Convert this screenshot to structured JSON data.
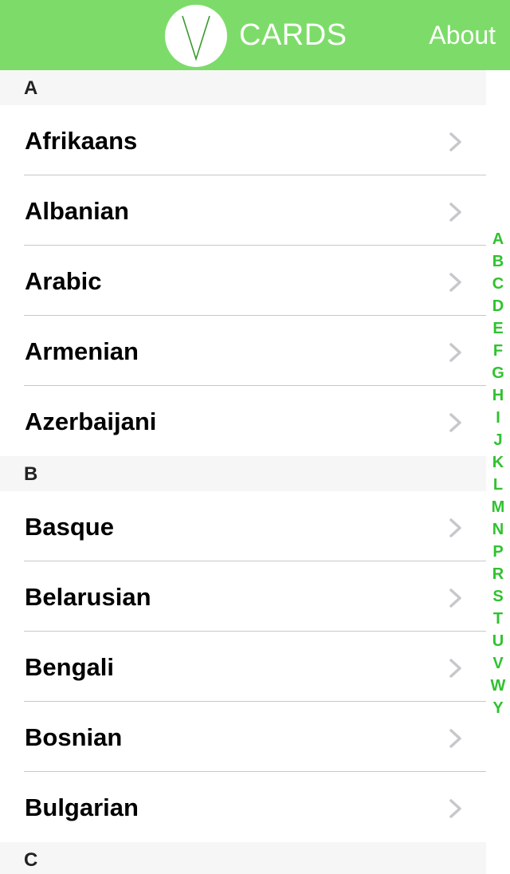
{
  "header": {
    "brand": "CARDS",
    "about_label": "About",
    "background_color": "#7ddc69",
    "logo_icon": "v-logo-icon"
  },
  "sections": [
    {
      "letter": "A",
      "items": [
        "Afrikaans",
        "Albanian",
        "Arabic",
        "Armenian",
        "Azerbaijani"
      ]
    },
    {
      "letter": "B",
      "items": [
        "Basque",
        "Belarusian",
        "Bengali",
        "Bosnian",
        "Bulgarian"
      ]
    },
    {
      "letter": "C",
      "items": []
    }
  ],
  "index_letters": [
    "A",
    "B",
    "C",
    "D",
    "E",
    "F",
    "G",
    "H",
    "I",
    "J",
    "K",
    "L",
    "M",
    "N",
    "P",
    "R",
    "S",
    "T",
    "U",
    "V",
    "W",
    "Y"
  ],
  "colors": {
    "index_color": "#2fc22f",
    "chevron_color": "#c7c7cc",
    "section_bg": "#f6f6f6"
  }
}
